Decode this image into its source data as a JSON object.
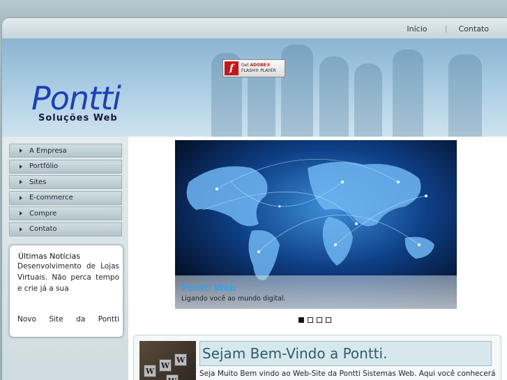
{
  "nav": {
    "home": "Início",
    "contact": "Contato"
  },
  "flash_badge": {
    "line1a": "Get",
    "line1b": "ADOBE®",
    "line2": "FLASH® PLAYER"
  },
  "logo": {
    "name": "Pontti",
    "tagline": "Soluções Web"
  },
  "menu": {
    "items": [
      "A Empresa",
      "Portfólio",
      "Sites",
      "E-commerce",
      "Compre",
      "Contato"
    ]
  },
  "news": {
    "title": "Últimas Notícias",
    "item1": "Desenvolvimento de Lojas Virtuais. Não perca tempo e crie já a sua",
    "item2": "Novo Site da Pontti"
  },
  "slider": {
    "caption_title": "Pontti Web",
    "caption_text": "Ligando você ao mundo digital.",
    "slide_count": 4,
    "active_slide": 1
  },
  "welcome": {
    "title": "Sejam Bem-Vindo a Pontti.",
    "text": "Seja Muito Bem vindo ao Web-Site da Pontti Sistemas Web. Aqui você conhecerá"
  },
  "colors": {
    "logo_blue": "#1d3fb8",
    "caption_blue": "#3aa0e6",
    "welcome_title": "#2f5b6e"
  }
}
